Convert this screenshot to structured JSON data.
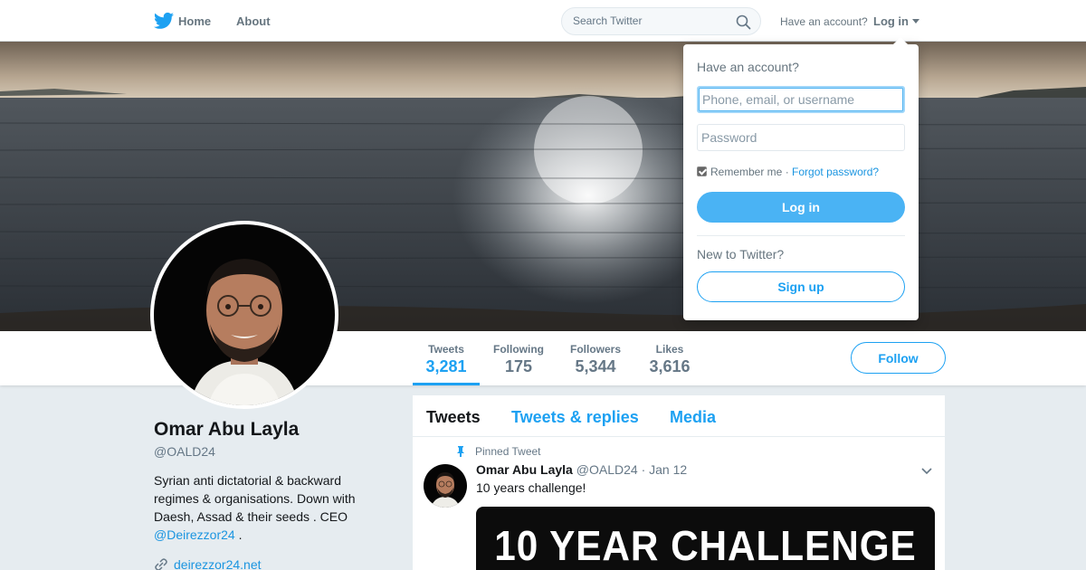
{
  "topbar": {
    "home_label": "Home",
    "about_label": "About",
    "search_placeholder": "Search Twitter",
    "have_account": "Have an account?",
    "login_label": "Log in"
  },
  "profile_nav": {
    "stats": [
      {
        "label": "Tweets",
        "value": "3,281",
        "active": true
      },
      {
        "label": "Following",
        "value": "175"
      },
      {
        "label": "Followers",
        "value": "5,344"
      },
      {
        "label": "Likes",
        "value": "3,616"
      }
    ],
    "follow_label": "Follow"
  },
  "profile": {
    "name": "Omar Abu Layla",
    "handle": "@OALD24",
    "bio_text": "Syrian anti dictatorial & backward regimes & organisations. Down with Daesh, Assad & their seeds . CEO",
    "bio_mention": "@Deirezzor24",
    "bio_tail": ".",
    "url": "deirezzor24.net"
  },
  "timeline": {
    "tabs": [
      {
        "label": "Tweets",
        "active": true
      },
      {
        "label": "Tweets & replies"
      },
      {
        "label": "Media"
      }
    ],
    "pinned_label": "Pinned Tweet",
    "tweet": {
      "fullname": "Omar Abu Layla",
      "handle": "@OALD24",
      "date": "Jan 12",
      "separator": "·",
      "text": "10 years challenge!",
      "media_text": "10 YEAR CHALLENGE"
    }
  },
  "login_dropdown": {
    "heading": "Have an account?",
    "username_placeholder": "Phone, email, or username",
    "password_placeholder": "Password",
    "remember_label": "Remember me",
    "separator": "·",
    "forgot_label": "Forgot password?",
    "login_button": "Log in",
    "new_label": "New to Twitter?",
    "signup_button": "Sign up"
  },
  "colors": {
    "accent": "#1da1f2",
    "login_button": "#4ab3f4",
    "page_bg": "#e6ecf0"
  },
  "icons": [
    "twitter-bird-icon",
    "search-icon",
    "pin-icon",
    "link-icon",
    "chevron-down-icon",
    "checkbox-checked"
  ]
}
